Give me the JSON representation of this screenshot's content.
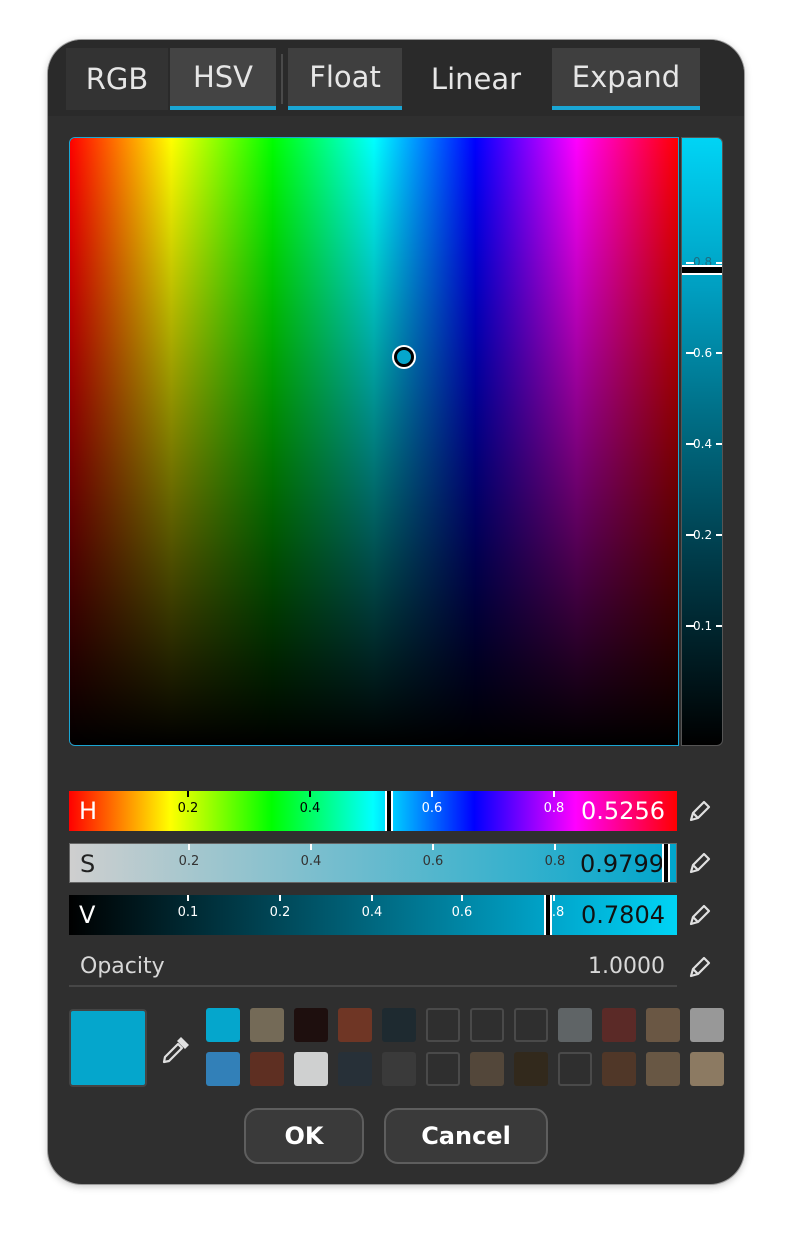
{
  "tabs": {
    "rgb": "RGB",
    "hsv": "HSV",
    "float": "Float",
    "linear": "Linear",
    "expand": "Expand"
  },
  "value_bar": {
    "tick_labels": [
      "0.8",
      "0.6",
      "0.4",
      "0.2",
      "0.1"
    ]
  },
  "sliders": {
    "h": {
      "label": "H",
      "value": "0.5256",
      "tick_labels": [
        "0.2",
        "0.4",
        "0.6",
        "0.8"
      ]
    },
    "s": {
      "label": "S",
      "value": "0.9799",
      "tick_labels": [
        "0.2",
        "0.4",
        "0.6",
        "0.8"
      ]
    },
    "v": {
      "label": "V",
      "value": "0.7804",
      "tick_labels": [
        "0.1",
        "0.2",
        "0.4",
        "0.6",
        "0.8"
      ]
    }
  },
  "opacity": {
    "label": "Opacity",
    "value": "1.0000"
  },
  "current_color": "#05a6cc",
  "swatches_row1": [
    "#05a6cc",
    "#746a57",
    "#1e0f0e",
    "#6f3625",
    "#1e2a30",
    "empty",
    "empty",
    "empty",
    "#5f6466",
    "#5b2a27",
    "#6a5744",
    "#989898"
  ],
  "swatches_row2": [
    "#3280b8",
    "#5e2f22",
    "#cfd0d0",
    "#273038",
    "#3a3a3a",
    "empty",
    "#53473a",
    "#32291c",
    "empty",
    "#503728",
    "#685744",
    "#8c7a62"
  ],
  "buttons": {
    "ok": "OK",
    "cancel": "Cancel"
  },
  "colors": {
    "accent": "#1aa6d4",
    "dialog_bg": "#2f2f2f"
  }
}
